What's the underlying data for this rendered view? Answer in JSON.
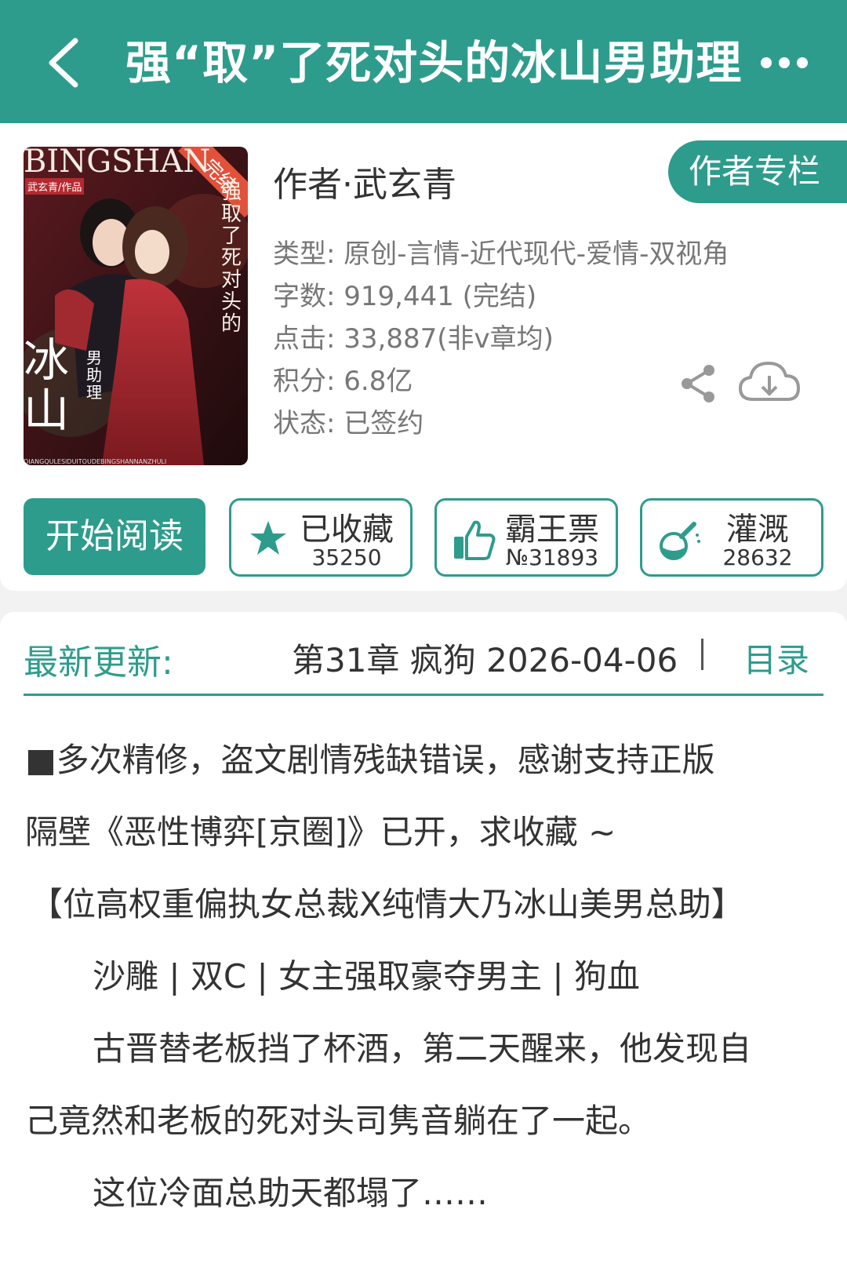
{
  "header": {
    "title": "强“取”了死对头的冰山男助理"
  },
  "book": {
    "cover_texts": {
      "badge": "完结",
      "brand": "BINGSHAN",
      "author_tag": "武玄青/作品",
      "title_top": "强取了死对头的",
      "title_main": "冰山",
      "title_sub": "男助理",
      "bottom": "QIANGQULESIDUITOUDEBINGSHANNANZHULI"
    },
    "author": "作者·武玄青",
    "author_column_label": "作者专栏",
    "meta": {
      "type": "类型: 原创-言情-近代现代-爱情-双视角",
      "words": "字数: 919,441 (完结)",
      "clicks": "点击: 33,887(非v章均)",
      "points": "积分: 6.8亿",
      "status": "状态: 已签约"
    }
  },
  "actions": {
    "read_label": "开始阅读",
    "favorite": {
      "label": "已收藏",
      "count": "35250"
    },
    "vote": {
      "label": "霸王票",
      "count": "№31893"
    },
    "water": {
      "label": "灌溉",
      "count": "28632"
    }
  },
  "update": {
    "label": "最新更新:",
    "text": "第31章  疯狗  2026-04-06",
    "toc_label": "目录"
  },
  "description": {
    "lines": [
      "■多次精修，盗文剧情残缺错误，感谢支持正版",
      "隔壁《恶性博弈[京圈]》已开，求收藏 ~",
      "【位高权重偏执女总裁X纯情大乃冰山美男总助】",
      "沙雕 | 双C | 女主强取豪夺男主 | 狗血",
      "古晋替老板挡了杯酒，第二天醒来，他发现自",
      "己竟然和老板的死对头司隽音躺在了一起。",
      "这位冷面总助天都塌了……"
    ]
  },
  "colors": {
    "accent": "#2e9c8c",
    "text": "#333333",
    "muted": "#777777"
  }
}
